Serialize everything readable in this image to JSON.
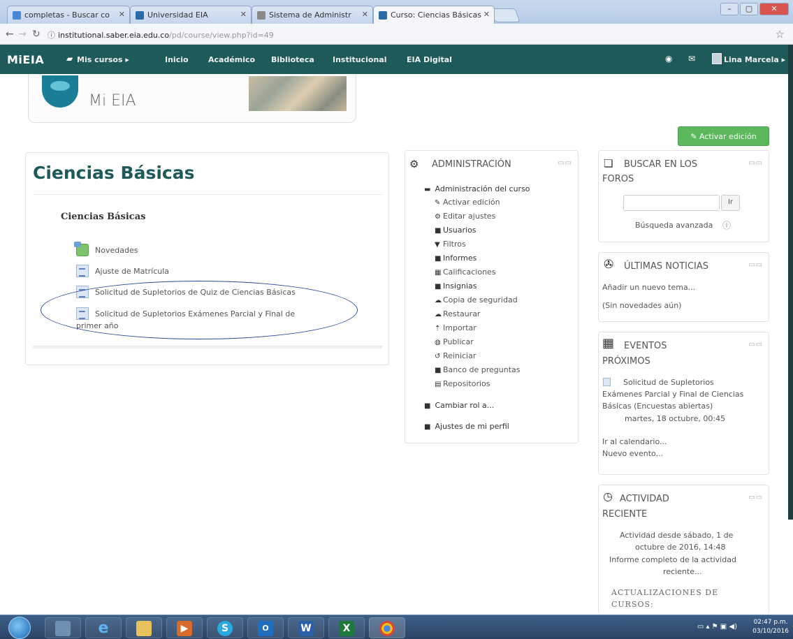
{
  "browser": {
    "tabs": [
      {
        "label": "completas - Buscar co"
      },
      {
        "label": "Universidad EIA"
      },
      {
        "label": "Sistema de Administr"
      },
      {
        "label": "Curso: Ciencias Básicas"
      }
    ],
    "url_host": "institutional.saber.eia.edu.co",
    "url_path": "/pd/course/view.php?id=49"
  },
  "navbar": {
    "brand": "MiEIA",
    "my_courses": "Mis cursos ▸",
    "items": [
      "Inicio",
      "Académico",
      "Biblioteca",
      "Institucional",
      "EIA Digital"
    ],
    "user": "Lina Marcela ▸"
  },
  "banner": {
    "logo_text": "Mi EIA"
  },
  "edit_button": "✎ Activar edición",
  "course": {
    "title": "Ciencias Básicas",
    "section": "Ciencias Básicas",
    "activities": [
      "Novedades",
      "Ajuste de Matrícula",
      "Solicitud de Supletorios de Quiz de Ciencias Básicas",
      "Solicitud de Supletorios Exámenes Parcial y Final de",
      "primer año"
    ]
  },
  "admin_block": {
    "title": "ADMINISTRACIÓN",
    "root": "Administración del curso",
    "items": [
      "Activar edición",
      "Editar ajustes",
      "Usuarios",
      "Filtros",
      "Informes",
      "Calificaciones",
      "Insignias",
      "Copia de seguridad",
      "Restaurar",
      "Importar",
      "Publicar",
      "Reiniciar",
      "Banco de preguntas",
      "Repositorios"
    ],
    "switch_role": "Cambiar rol a...",
    "profile_settings": "Ajustes de mi perfil"
  },
  "forum_search_block": {
    "title_line1": "BUSCAR EN LOS",
    "title_line2": "FOROS",
    "button": "Ir",
    "advanced": "Búsqueda avanzada"
  },
  "news_block": {
    "title": "ÚLTIMAS NOTICIAS",
    "add": "Añadir un nuevo tema...",
    "empty": "(Sin novedades aún)"
  },
  "events_block": {
    "title_line1": "EVENTOS",
    "title_line2": "PRÓXIMOS",
    "event_line1": "Solicitud de Supletorios",
    "event_line2": "Exámenes Parcial y Final de Ciencias",
    "event_line3": "Básicas (Encuestas abiertas)",
    "event_date": "martes, 18 octubre, 00:45",
    "calendar": "Ir al calendario...",
    "new_event": "Nuevo evento..."
  },
  "recent_block": {
    "title_line1": "ACTIVIDAD",
    "title_line2": "RECIENTE",
    "since_line1": "Actividad desde sábado, 1 de",
    "since_line2": "octubre de 2016, 14:48",
    "report_line1": "Informe completo de la actividad",
    "report_line2": "reciente...",
    "updates_line1": "ACTUALIZACIONES DE",
    "updates_line2": "CURSOS:"
  },
  "taskbar": {
    "time": "02:47 p.m.",
    "date": "03/10/2016"
  }
}
